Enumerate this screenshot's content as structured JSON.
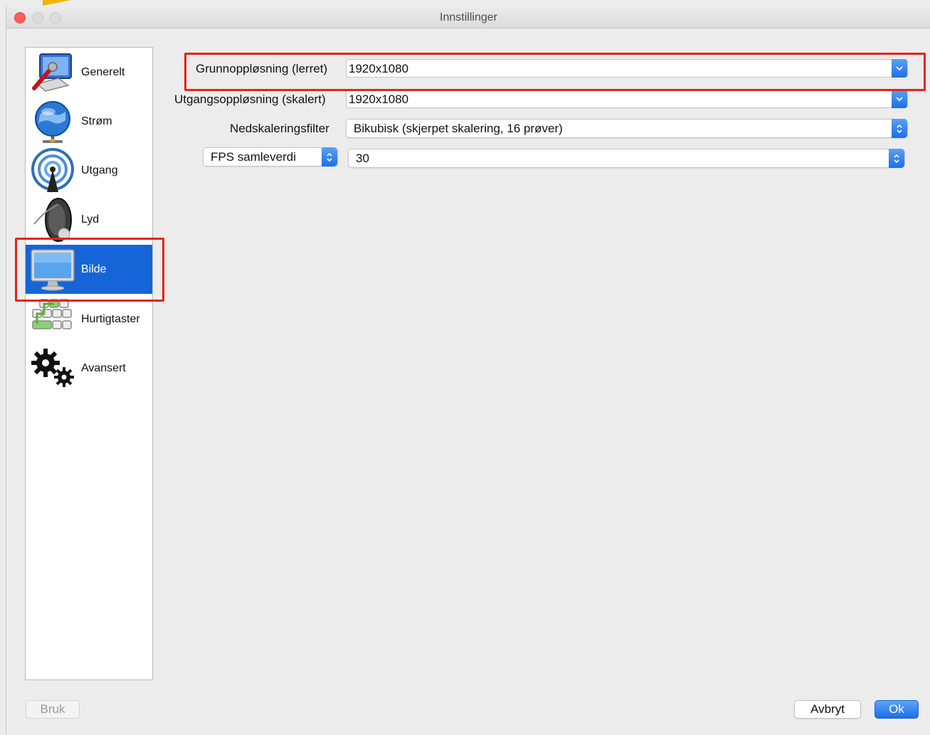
{
  "window": {
    "title": "Innstillinger"
  },
  "sidebar": {
    "items": [
      {
        "label": "Generelt",
        "icon": "wrench-computer-icon"
      },
      {
        "label": "Strøm",
        "icon": "globe-network-icon"
      },
      {
        "label": "Utgang",
        "icon": "broadcast-antenna-icon"
      },
      {
        "label": "Lyd",
        "icon": "speaker-icon"
      },
      {
        "label": "Bilde",
        "icon": "monitor-icon",
        "active": true
      },
      {
        "label": "Hurtigtaster",
        "icon": "keyboard-keys-icon"
      },
      {
        "label": "Avansert",
        "icon": "gears-icon"
      }
    ]
  },
  "video": {
    "base_resolution": {
      "label": "Grunnoppløsning (lerret)",
      "value": "1920x1080"
    },
    "output_resolution": {
      "label": "Utgangsoppløsning (skalert)",
      "value": "1920x1080"
    },
    "downscale_filter": {
      "label": "Nedskaleringsfilter",
      "value": "Bikubisk (skjerpet skalering, 16 prøver)"
    },
    "fps_type": {
      "value": "FPS samleverdi"
    },
    "fps_value": {
      "value": "30"
    }
  },
  "buttons": {
    "apply": "Bruk",
    "cancel": "Avbryt",
    "ok": "Ok"
  },
  "colors": {
    "accent": "#1565d8",
    "highlight": "#e3241b"
  }
}
